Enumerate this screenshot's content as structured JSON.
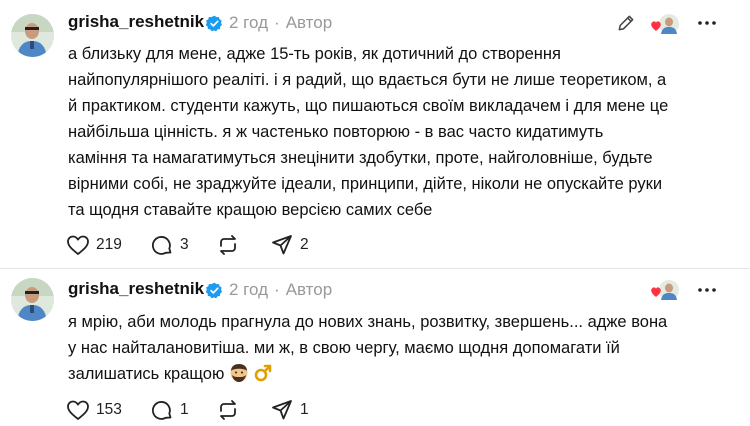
{
  "posts": [
    {
      "username": "grisha_reshetnik",
      "time": "2 год",
      "separator": "·",
      "author_tag": "Автор",
      "text_lines": [
        "а близьку для мене, адже 15-ть років, як дотичний до створення",
        "найпопулярнішого реаліті. і я радий, що вдається бути не лише теоретиком, а",
        "й практиком. студенти кажуть, що пишаються своїм викладачем і для мене це",
        "найбільша цінність. я ж частенько повторюю - в вас часто кидатимуть",
        "каміння та намагатимуться знецінити здобутки, проте, найголовніше, будьте",
        "вірними собі, не зраджуйте ідеали, принципи, дійте, ніколи не опускайте руки",
        "та щодня ставайте кращою версією самих себе"
      ],
      "likes": "219",
      "replies": "3",
      "reposts": "",
      "shares": "2"
    },
    {
      "username": "grisha_reshetnik",
      "time": "2 год",
      "separator": "·",
      "author_tag": "Автор",
      "text_lines": [
        "я мрію, аби молодь прагнула до нових знань, розвитку, звершень... адже вона",
        "у нас найталановитіша. ми ж, в свою чергу, маємо щодня допомагати їй",
        "залишатись кращою"
      ],
      "likes": "153",
      "replies": "1",
      "reposts": "",
      "shares": "1"
    }
  ],
  "colors": {
    "verified": "#1d9bf0",
    "heart": "#ff3040",
    "muted": "#999999"
  },
  "icons": [
    "verified-badge-icon",
    "edit-icon",
    "liked-by-author-icon",
    "heart-icon",
    "comment-icon",
    "repost-icon",
    "share-icon",
    "man-emoji-icon",
    "male-sign-emoji-icon"
  ]
}
